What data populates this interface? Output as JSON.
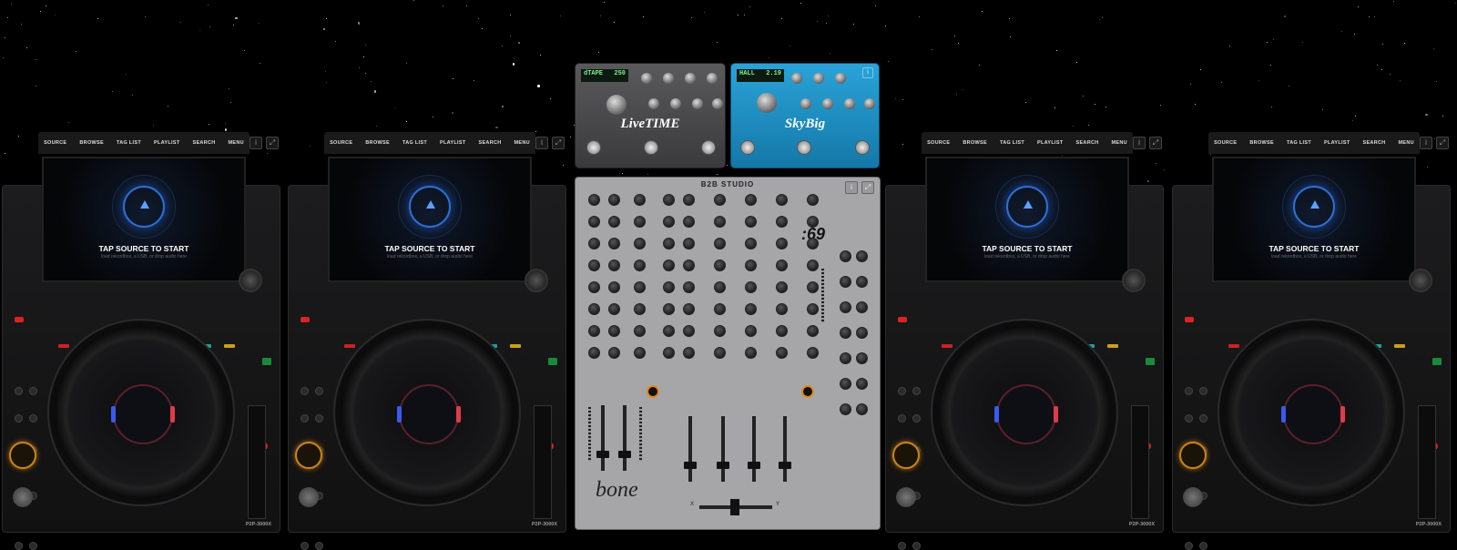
{
  "decks": [
    {
      "id": "deck-1",
      "menu": [
        "SOURCE",
        "BROWSE",
        "TAG LIST",
        "PLAYLIST",
        "SEARCH",
        "MENU"
      ],
      "screen_title": "TAP SOURCE TO START",
      "screen_subtitle": "load rekordbox, a USB, or drop audio here",
      "model": "P2P-3000X"
    },
    {
      "id": "deck-2",
      "menu": [
        "SOURCE",
        "BROWSE",
        "TAG LIST",
        "PLAYLIST",
        "SEARCH",
        "MENU"
      ],
      "screen_title": "TAP SOURCE TO START",
      "screen_subtitle": "load rekordbox, a USB, or drop audio here",
      "model": "P2P-3000X"
    },
    {
      "id": "deck-3",
      "menu": [
        "SOURCE",
        "BROWSE",
        "TAG LIST",
        "PLAYLIST",
        "SEARCH",
        "MENU"
      ],
      "screen_title": "TAP SOURCE TO START",
      "screen_subtitle": "load rekordbox, a USB, or drop audio here",
      "model": "P2P-3000X"
    },
    {
      "id": "deck-4",
      "menu": [
        "SOURCE",
        "BROWSE",
        "TAG LIST",
        "PLAYLIST",
        "SEARCH",
        "MENU"
      ],
      "screen_title": "TAP SOURCE TO START",
      "screen_subtitle": "load rekordbox, a USB, or drop audio here",
      "model": "P2P-3000X"
    }
  ],
  "pedals": [
    {
      "id": "delay",
      "display_mode": "dTAPE",
      "display_value": "250",
      "name": "LiveTIME",
      "color": "#4a4a4c"
    },
    {
      "id": "reverb",
      "display_mode": "HALL",
      "display_value": "2.19",
      "name": "SkyBig",
      "color": "#1f8fc0"
    }
  ],
  "mixer": {
    "title": "B2B STUDIO",
    "brand": "bone",
    "model_number": ":69",
    "crossfader_left": "X",
    "crossfader_right": "Y"
  },
  "icons": {
    "info": "info-icon",
    "expand": "expand-icon"
  },
  "colors": {
    "accent_blue": "#2f6fd6",
    "cue_orange": "#e08a1c",
    "background": "#000000"
  }
}
